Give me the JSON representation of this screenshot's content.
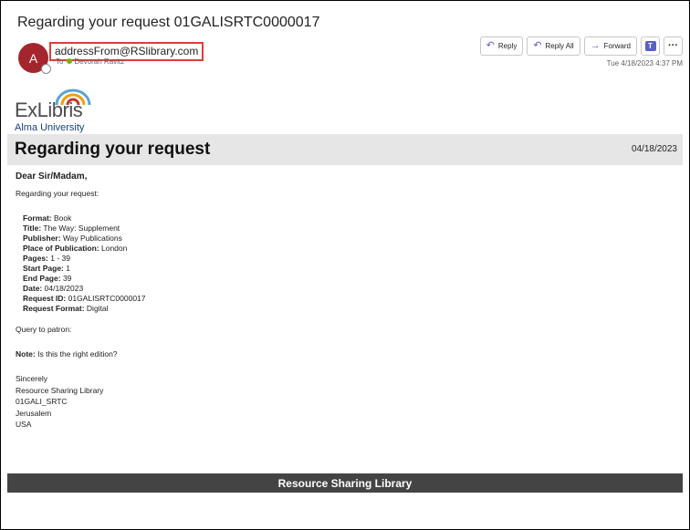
{
  "email": {
    "subject": "Regarding your request 01GALISRTC0000017",
    "avatar_initial": "A",
    "from": "addressFrom@RSlibrary.com",
    "to_label": "To",
    "to_name": "Devorah Ravitz",
    "timestamp": "Tue 4/18/2023 4:37 PM",
    "actions": {
      "reply": "Reply",
      "reply_all": "Reply All",
      "forward": "Forward"
    }
  },
  "letter": {
    "logo_text": "ExLibris",
    "logo_sub": "Alma University",
    "banner_title": "Regarding your request",
    "banner_date": "04/18/2023",
    "greeting": "Dear Sir/Madam,",
    "intro": "Regarding your request:",
    "details": [
      {
        "label": "Format:",
        "value": "Book"
      },
      {
        "label": "Title:",
        "value": "The Way: Supplement"
      },
      {
        "label": "Publisher:",
        "value": "Way Publications"
      },
      {
        "label": "Place of Publication:",
        "value": "London"
      },
      {
        "label": "Pages:",
        "value": "1 - 39"
      },
      {
        "label": "Start Page:",
        "value": "1"
      },
      {
        "label": "End Page:",
        "value": "39"
      },
      {
        "label": "Date:",
        "value": "04/18/2023"
      },
      {
        "label": "Request ID:",
        "value": "01GALISRTC0000017"
      },
      {
        "label": "Request Format:",
        "value": "Digital"
      }
    ],
    "query": "Query to patron:",
    "note_label": "Note:",
    "note_text": "Is this the right edition?",
    "signature": [
      "Sincerely",
      "Resource Sharing Library",
      "01GALI_SRTC",
      "Jerusalem",
      "USA"
    ],
    "footer": "Resource Sharing Library"
  },
  "colors": {
    "avatar_bg": "#a4262c",
    "highlight_border": "#e33b3b",
    "banner_bg": "#e6e6e6",
    "footer_bg": "#444444",
    "accent": "#5b5fc7"
  }
}
